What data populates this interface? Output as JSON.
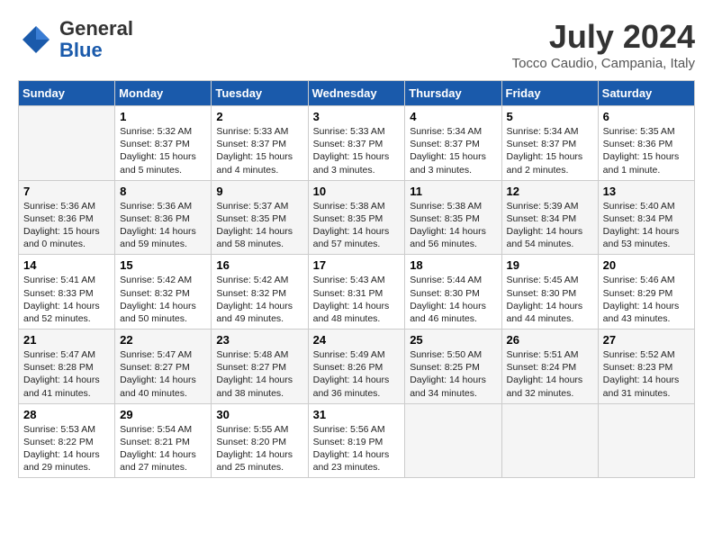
{
  "header": {
    "logo_general": "General",
    "logo_blue": "Blue",
    "month_year": "July 2024",
    "location": "Tocco Caudio, Campania, Italy"
  },
  "days_of_week": [
    "Sunday",
    "Monday",
    "Tuesday",
    "Wednesday",
    "Thursday",
    "Friday",
    "Saturday"
  ],
  "weeks": [
    [
      {
        "day": "",
        "content": ""
      },
      {
        "day": "1",
        "content": "Sunrise: 5:32 AM\nSunset: 8:37 PM\nDaylight: 15 hours\nand 5 minutes."
      },
      {
        "day": "2",
        "content": "Sunrise: 5:33 AM\nSunset: 8:37 PM\nDaylight: 15 hours\nand 4 minutes."
      },
      {
        "day": "3",
        "content": "Sunrise: 5:33 AM\nSunset: 8:37 PM\nDaylight: 15 hours\nand 3 minutes."
      },
      {
        "day": "4",
        "content": "Sunrise: 5:34 AM\nSunset: 8:37 PM\nDaylight: 15 hours\nand 3 minutes."
      },
      {
        "day": "5",
        "content": "Sunrise: 5:34 AM\nSunset: 8:37 PM\nDaylight: 15 hours\nand 2 minutes."
      },
      {
        "day": "6",
        "content": "Sunrise: 5:35 AM\nSunset: 8:36 PM\nDaylight: 15 hours\nand 1 minute."
      }
    ],
    [
      {
        "day": "7",
        "content": "Sunrise: 5:36 AM\nSunset: 8:36 PM\nDaylight: 15 hours\nand 0 minutes."
      },
      {
        "day": "8",
        "content": "Sunrise: 5:36 AM\nSunset: 8:36 PM\nDaylight: 14 hours\nand 59 minutes."
      },
      {
        "day": "9",
        "content": "Sunrise: 5:37 AM\nSunset: 8:35 PM\nDaylight: 14 hours\nand 58 minutes."
      },
      {
        "day": "10",
        "content": "Sunrise: 5:38 AM\nSunset: 8:35 PM\nDaylight: 14 hours\nand 57 minutes."
      },
      {
        "day": "11",
        "content": "Sunrise: 5:38 AM\nSunset: 8:35 PM\nDaylight: 14 hours\nand 56 minutes."
      },
      {
        "day": "12",
        "content": "Sunrise: 5:39 AM\nSunset: 8:34 PM\nDaylight: 14 hours\nand 54 minutes."
      },
      {
        "day": "13",
        "content": "Sunrise: 5:40 AM\nSunset: 8:34 PM\nDaylight: 14 hours\nand 53 minutes."
      }
    ],
    [
      {
        "day": "14",
        "content": "Sunrise: 5:41 AM\nSunset: 8:33 PM\nDaylight: 14 hours\nand 52 minutes."
      },
      {
        "day": "15",
        "content": "Sunrise: 5:42 AM\nSunset: 8:32 PM\nDaylight: 14 hours\nand 50 minutes."
      },
      {
        "day": "16",
        "content": "Sunrise: 5:42 AM\nSunset: 8:32 PM\nDaylight: 14 hours\nand 49 minutes."
      },
      {
        "day": "17",
        "content": "Sunrise: 5:43 AM\nSunset: 8:31 PM\nDaylight: 14 hours\nand 48 minutes."
      },
      {
        "day": "18",
        "content": "Sunrise: 5:44 AM\nSunset: 8:30 PM\nDaylight: 14 hours\nand 46 minutes."
      },
      {
        "day": "19",
        "content": "Sunrise: 5:45 AM\nSunset: 8:30 PM\nDaylight: 14 hours\nand 44 minutes."
      },
      {
        "day": "20",
        "content": "Sunrise: 5:46 AM\nSunset: 8:29 PM\nDaylight: 14 hours\nand 43 minutes."
      }
    ],
    [
      {
        "day": "21",
        "content": "Sunrise: 5:47 AM\nSunset: 8:28 PM\nDaylight: 14 hours\nand 41 minutes."
      },
      {
        "day": "22",
        "content": "Sunrise: 5:47 AM\nSunset: 8:27 PM\nDaylight: 14 hours\nand 40 minutes."
      },
      {
        "day": "23",
        "content": "Sunrise: 5:48 AM\nSunset: 8:27 PM\nDaylight: 14 hours\nand 38 minutes."
      },
      {
        "day": "24",
        "content": "Sunrise: 5:49 AM\nSunset: 8:26 PM\nDaylight: 14 hours\nand 36 minutes."
      },
      {
        "day": "25",
        "content": "Sunrise: 5:50 AM\nSunset: 8:25 PM\nDaylight: 14 hours\nand 34 minutes."
      },
      {
        "day": "26",
        "content": "Sunrise: 5:51 AM\nSunset: 8:24 PM\nDaylight: 14 hours\nand 32 minutes."
      },
      {
        "day": "27",
        "content": "Sunrise: 5:52 AM\nSunset: 8:23 PM\nDaylight: 14 hours\nand 31 minutes."
      }
    ],
    [
      {
        "day": "28",
        "content": "Sunrise: 5:53 AM\nSunset: 8:22 PM\nDaylight: 14 hours\nand 29 minutes."
      },
      {
        "day": "29",
        "content": "Sunrise: 5:54 AM\nSunset: 8:21 PM\nDaylight: 14 hours\nand 27 minutes."
      },
      {
        "day": "30",
        "content": "Sunrise: 5:55 AM\nSunset: 8:20 PM\nDaylight: 14 hours\nand 25 minutes."
      },
      {
        "day": "31",
        "content": "Sunrise: 5:56 AM\nSunset: 8:19 PM\nDaylight: 14 hours\nand 23 minutes."
      },
      {
        "day": "",
        "content": ""
      },
      {
        "day": "",
        "content": ""
      },
      {
        "day": "",
        "content": ""
      }
    ]
  ]
}
